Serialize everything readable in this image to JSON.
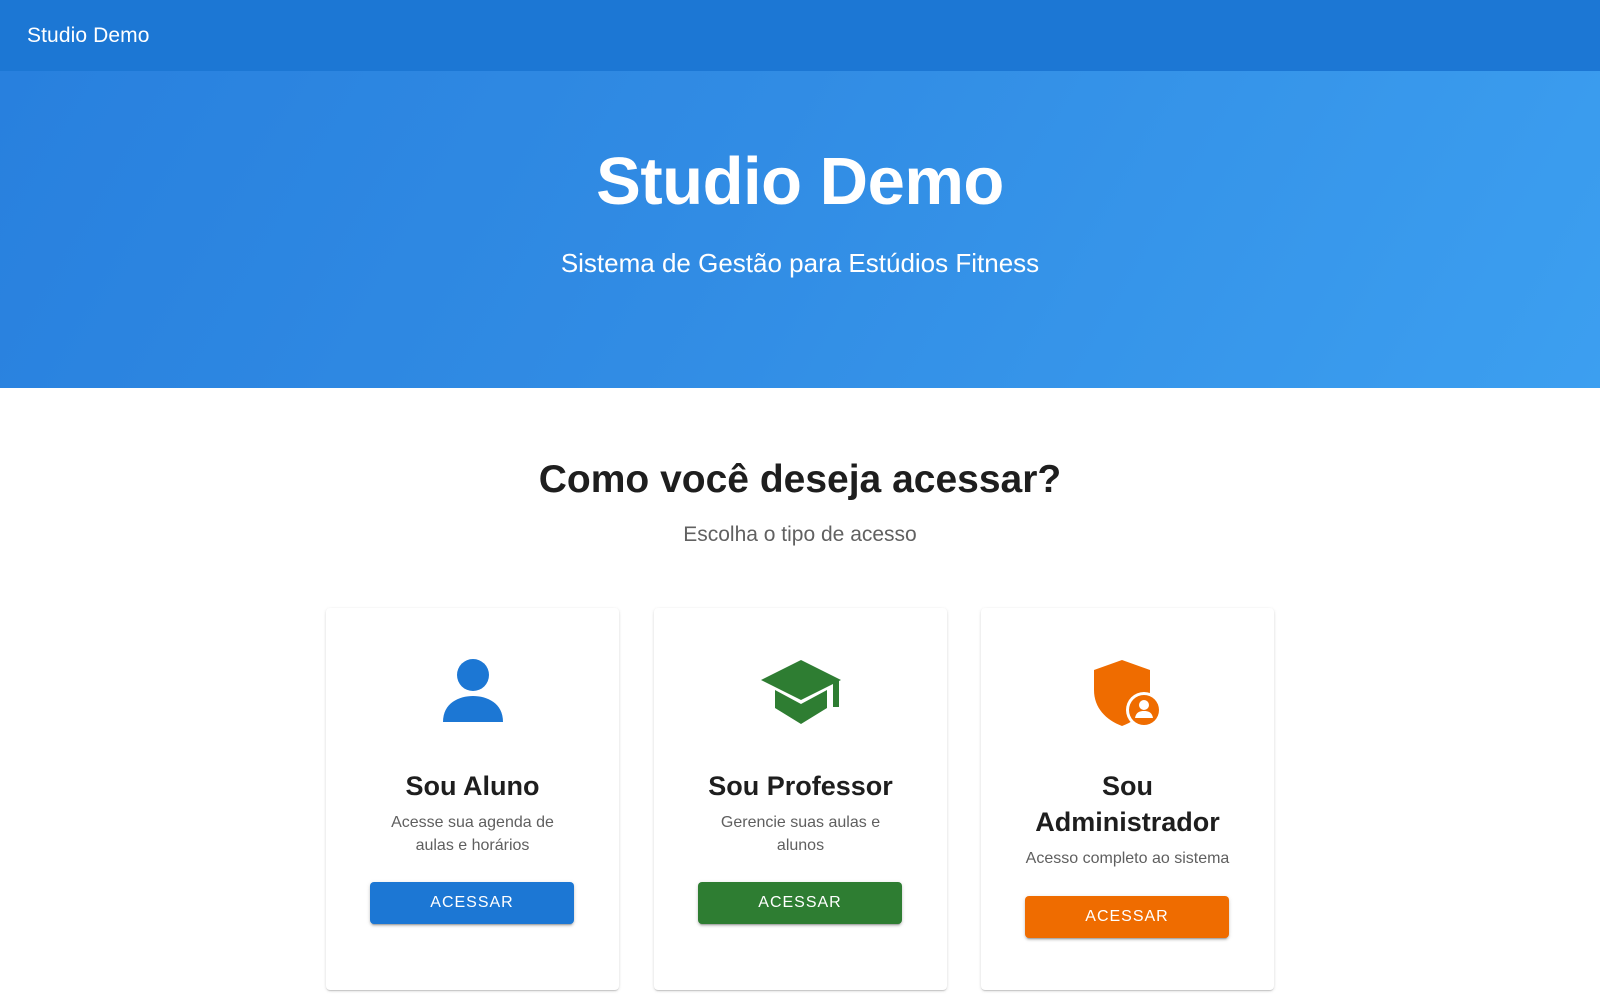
{
  "appbar": {
    "title": "Studio Demo"
  },
  "hero": {
    "title": "Studio Demo",
    "subtitle": "Sistema de Gestão para Estúdios Fitness"
  },
  "access": {
    "title": "Como você deseja acessar?",
    "subtitle": "Escolha o tipo de acesso"
  },
  "colors": {
    "primary": "#1c77d4",
    "success": "#2e7d32",
    "warning": "#ef6c00"
  },
  "cards": [
    {
      "icon": "person-icon",
      "title": "Sou Aluno",
      "description": "Acesse sua agenda de aulas e horários",
      "button_label": "ACESSAR"
    },
    {
      "icon": "graduation-cap-icon",
      "title": "Sou Professor",
      "description": "Gerencie suas aulas e alunos",
      "button_label": "ACESSAR"
    },
    {
      "icon": "admin-shield-icon",
      "title": "Sou Administrador",
      "description": "Acesso completo ao sistema",
      "button_label": "ACESSAR"
    }
  ]
}
